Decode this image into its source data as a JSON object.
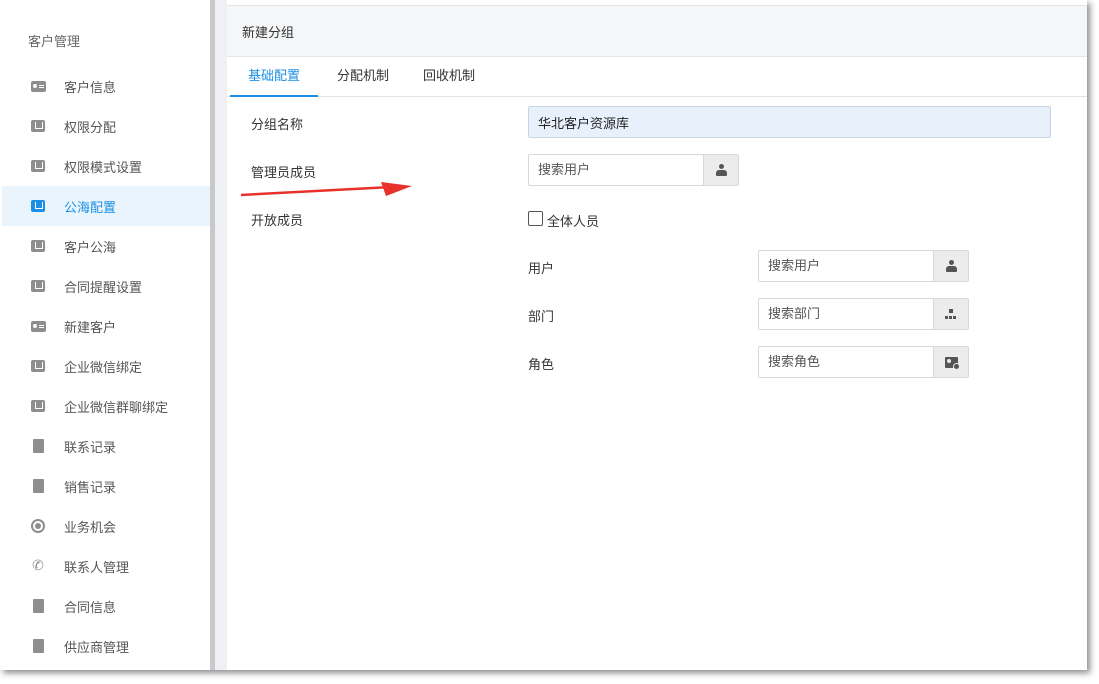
{
  "sidebar": {
    "title": "客户管理",
    "items": [
      {
        "label": "客户信息",
        "icon": "contact-card-icon"
      },
      {
        "label": "权限分配",
        "icon": "box-icon"
      },
      {
        "label": "权限模式设置",
        "icon": "box-icon"
      },
      {
        "label": "公海配置",
        "icon": "box-icon",
        "active": true
      },
      {
        "label": "客户公海",
        "icon": "box-icon"
      },
      {
        "label": "合同提醒设置",
        "icon": "box-icon"
      },
      {
        "label": "新建客户",
        "icon": "contact-card-icon"
      },
      {
        "label": "企业微信绑定",
        "icon": "box-icon"
      },
      {
        "label": "企业微信群聊绑定",
        "icon": "box-icon"
      },
      {
        "label": "联系记录",
        "icon": "document-icon"
      },
      {
        "label": "销售记录",
        "icon": "document-icon"
      },
      {
        "label": "业务机会",
        "icon": "target-icon"
      },
      {
        "label": "联系人管理",
        "icon": "phone-icon"
      },
      {
        "label": "合同信息",
        "icon": "contract-icon"
      },
      {
        "label": "供应商管理",
        "icon": "supplier-icon"
      }
    ]
  },
  "panel": {
    "title": "新建分组",
    "tabs": [
      "基础配置",
      "分配机制",
      "回收机制"
    ],
    "active_tab": "基础配置"
  },
  "form": {
    "group_name_label": "分组名称",
    "group_name_value": "华北客户资源库",
    "admin_label": "管理员成员",
    "admin_placeholder": "搜索用户",
    "open_label": "开放成员",
    "all_members_label": "全体人员",
    "user_label": "用户",
    "user_placeholder": "搜索用户",
    "dept_label": "部门",
    "dept_placeholder": "搜索部门",
    "role_label": "角色",
    "role_placeholder": "搜索角色"
  },
  "colors": {
    "accent": "#1b8fe4",
    "annotation_arrow": "#e8312a",
    "input_highlight": "#e8f0fc"
  }
}
